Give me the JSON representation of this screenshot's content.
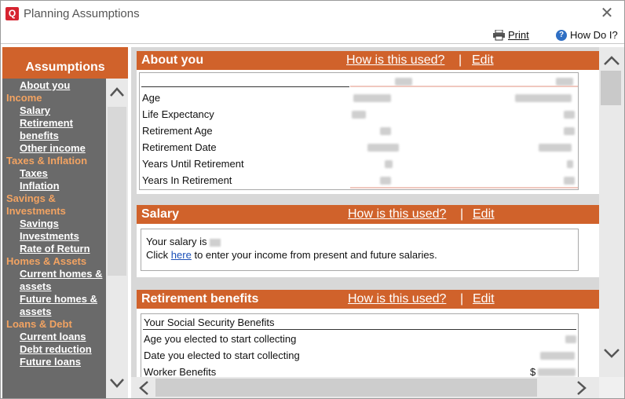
{
  "window": {
    "title": "Planning Assumptions",
    "close_icon": "close-icon"
  },
  "toolbar": {
    "print_label": "Print",
    "howdoi_label": "How Do I?",
    "help_glyph": "?"
  },
  "sidebar": {
    "header": "Assumptions",
    "entries": [
      {
        "kind": "item",
        "label": "About you"
      },
      {
        "kind": "cat",
        "label": "Income"
      },
      {
        "kind": "item",
        "label": "Salary"
      },
      {
        "kind": "item",
        "label": "Retirement\nbenefits"
      },
      {
        "kind": "item",
        "label": "Other income"
      },
      {
        "kind": "cat",
        "label": "Taxes & Inflation"
      },
      {
        "kind": "item",
        "label": "Taxes"
      },
      {
        "kind": "item",
        "label": "Inflation"
      },
      {
        "kind": "cat",
        "label": "Savings &\nInvestments"
      },
      {
        "kind": "item",
        "label": "Savings"
      },
      {
        "kind": "item",
        "label": "Investments"
      },
      {
        "kind": "item",
        "label": "Rate of Return"
      },
      {
        "kind": "cat",
        "label": "Homes & Assets"
      },
      {
        "kind": "item",
        "label": "Current homes &\nassets"
      },
      {
        "kind": "item",
        "label": "Future homes &\nassets"
      },
      {
        "kind": "cat",
        "label": "Loans & Debt"
      },
      {
        "kind": "item",
        "label": "Current loans"
      },
      {
        "kind": "item",
        "label": "Debt reduction"
      },
      {
        "kind": "item",
        "label": "Future loans"
      }
    ]
  },
  "panels": {
    "about": {
      "title": "About you",
      "how_label": "How is this used?",
      "sep": "|",
      "edit_label": "Edit",
      "rows": [
        "Age",
        "Life Expectancy",
        "Retirement Age",
        "Retirement Date",
        "Years Until Retirement",
        "Years In Retirement"
      ]
    },
    "salary": {
      "title": "Salary",
      "how_label": "How is this used?",
      "sep": "|",
      "edit_label": "Edit",
      "line1": "Your salary is",
      "line2_pre": "Click",
      "line2_link": "here",
      "line2_post": "to enter your income from present and future salaries."
    },
    "retirement": {
      "title": "Retirement benefits",
      "how_label": "How is this used?",
      "sep": "|",
      "edit_label": "Edit",
      "subheader": "Your Social Security Benefits",
      "rows": [
        "Age you elected to start collecting",
        "Date you elected to start collecting",
        "Worker Benefits"
      ],
      "worker_prefix": "$"
    }
  },
  "colors": {
    "accent": "#d0622b",
    "sidebar_bg": "#6a6a6a",
    "category": "#f2a362",
    "link": "#1a4fb8"
  }
}
